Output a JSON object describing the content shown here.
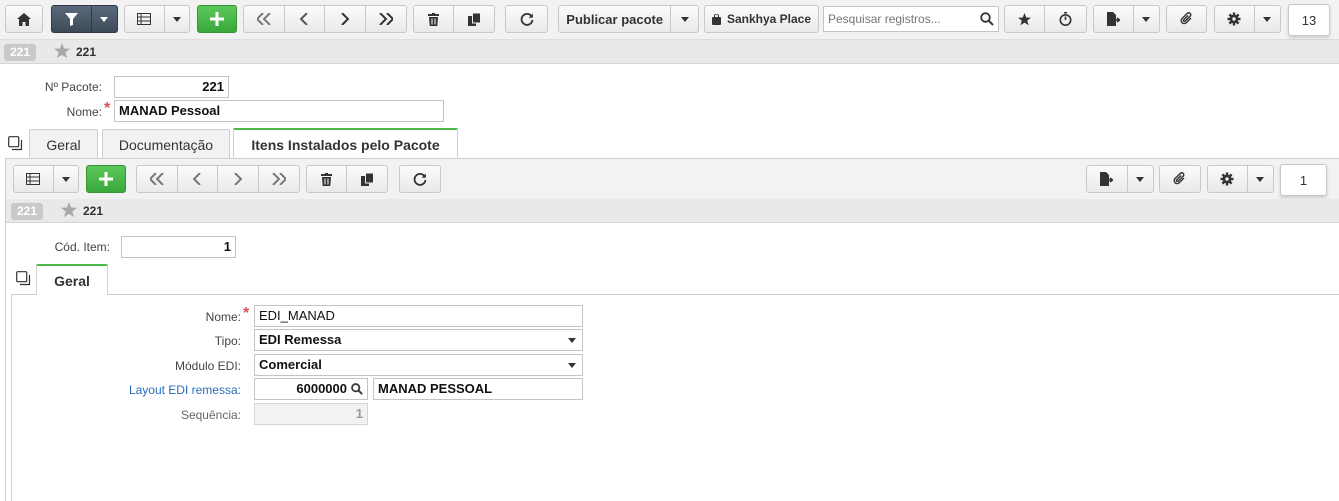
{
  "toolbar": {
    "publish_label": "Publicar pacote",
    "place_label": "Sankhya Place",
    "search_placeholder": "Pesquisar registros...",
    "record_count": "13"
  },
  "record": {
    "badge": "221",
    "title": "221"
  },
  "form": {
    "pacote_label": "Nº Pacote:",
    "pacote_value": "221",
    "nome_label": "Nome:",
    "nome_value": "MANAD Pessoal"
  },
  "tabs": [
    {
      "label": "Geral"
    },
    {
      "label": "Documentação"
    },
    {
      "label": "Itens Instalados pelo Pacote"
    }
  ],
  "detail": {
    "record_count": "1",
    "record_badge": "221",
    "record_title": "221",
    "cod_item_label": "Cód. Item:",
    "cod_item_value": "1",
    "tab_label": "Geral",
    "nome_label": "Nome:",
    "nome_value": "EDI_MANAD",
    "tipo_label": "Tipo:",
    "tipo_value": "EDI Remessa",
    "modulo_label": "Módulo EDI:",
    "modulo_value": "Comercial",
    "layout_label": "Layout EDI remessa:",
    "layout_code": "6000000",
    "layout_desc": "MANAD PESSOAL",
    "sequencia_label": "Sequência:",
    "sequencia_value": "1"
  },
  "colors": {
    "accent_green": "#4cb84c",
    "required": "#d9534f",
    "link": "#2a6ebb"
  }
}
